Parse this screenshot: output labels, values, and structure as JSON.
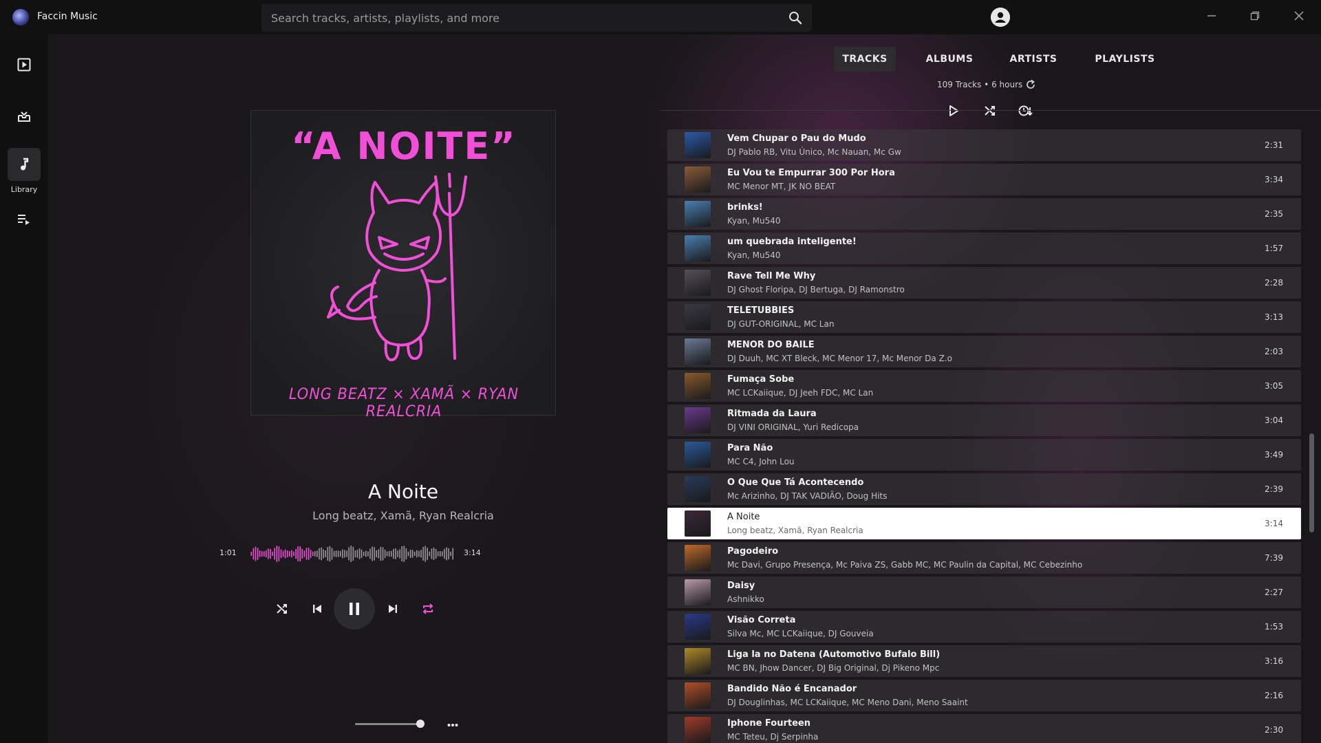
{
  "app": {
    "title": "Faccin Music"
  },
  "search": {
    "placeholder": "Search tracks, artists, playlists, and more"
  },
  "sidebar": {
    "items": [
      {
        "icon": "play-box-icon"
      },
      {
        "icon": "inbox-down-icon"
      },
      {
        "icon": "music-note-icon",
        "label": "Library"
      },
      {
        "icon": "queue-icon"
      }
    ]
  },
  "now_playing": {
    "cover": {
      "title": "“A NOITE”",
      "credits": "LONG BEATZ × XAMÃ × RYAN REALCRIA"
    },
    "title": "A Noite",
    "artists": "Long beatz,   Xamã,   Ryan Realcria",
    "elapsed": "1:01",
    "duration": "3:14",
    "progress": 0.31,
    "volume": 0.82
  },
  "library": {
    "tabs": [
      "TRACKS",
      "ALBUMS",
      "ARTISTS",
      "PLAYLISTS"
    ],
    "active_tab": "TRACKS",
    "summary": "109 Tracks • 6 hours"
  },
  "colors": {
    "accent": "#f14fd7",
    "active_row": "#ffffff"
  },
  "tracks": [
    {
      "title": "Vem Chupar o Pau do Mudo",
      "artists": "DJ Pablo RB,   Vitu Único,   Mc Nauan,   Mc Gw",
      "duration": "2:31",
      "thumb": "#2b5aa8"
    },
    {
      "title": "Eu Vou te Empurrar 300 Por Hora",
      "artists": "MC Menor MT,   JK NO BEAT",
      "duration": "3:34",
      "thumb": "#8a5b3a"
    },
    {
      "title": "brinks!",
      "artists": "Kyan,   Mu540",
      "duration": "2:35",
      "thumb": "#4a7fb0"
    },
    {
      "title": "um quebrada inteligente!",
      "artists": "Kyan,   Mu540",
      "duration": "1:57",
      "thumb": "#4a7fb0"
    },
    {
      "title": "Rave Tell Me Why",
      "artists": "DJ Ghost Floripa,   DJ Bertuga,   DJ Ramonstro",
      "duration": "2:28",
      "thumb": "#555058"
    },
    {
      "title": "TELETUBBIES",
      "artists": "DJ GUT-ORIGINAL,   MC Lan",
      "duration": "3:13",
      "thumb": "#3a3a44"
    },
    {
      "title": "MENOR DO BAILE",
      "artists": "DJ Duuh,   MC XT Bleck,   MC Menor 17,   Mc Menor Da Z.o",
      "duration": "2:03",
      "thumb": "#6a7a96"
    },
    {
      "title": "Fumaça Sobe",
      "artists": "MC LCKaiique,   DJ Jeeh FDC,   MC Lan",
      "duration": "3:05",
      "thumb": "#8a5a2a"
    },
    {
      "title": "Ritmada da Laura",
      "artists": "DJ VINI ORIGINAL,   Yuri Redicopa",
      "duration": "3:04",
      "thumb": "#6a3a8a"
    },
    {
      "title": "Para Não",
      "artists": "MC C4,   John Lou",
      "duration": "3:49",
      "thumb": "#2a5a9a"
    },
    {
      "title": "O Que Que Tá Acontecendo",
      "artists": "Mc Arizinho,   DJ TAK VADIÃO,   Doug Hits",
      "duration": "2:39",
      "thumb": "#2a3a5a"
    },
    {
      "title": "A Noite",
      "artists": "Long beatz,   Xamã,   Ryan Realcria",
      "duration": "3:14",
      "thumb": "#3a2838",
      "active": true
    },
    {
      "title": "Pagodeiro",
      "artists": "Mc Davi,   Grupo Presença,   Mc Paiva ZS,   Gabb MC,   MC Paulin da Capital,   MC Cebezinho",
      "duration": "7:39",
      "thumb": "#c06a2a"
    },
    {
      "title": "Daisy",
      "artists": "Ashnikko",
      "duration": "2:27",
      "thumb": "#b89aa8"
    },
    {
      "title": "Visão Correta",
      "artists": "Silva Mc,   MC LCKaiique,   DJ Gouveia",
      "duration": "1:53",
      "thumb": "#2a3a8a"
    },
    {
      "title": "Liga la no Datena (Automotivo Bufalo Bill)",
      "artists": "MC BN,   Jhow Dancer,   DJ Big Original,   Dj Pikeno Mpc",
      "duration": "3:16",
      "thumb": "#b08a2a"
    },
    {
      "title": "Bandido Não é Encanador",
      "artists": "DJ Douglinhas,   MC LCKaiique,   MC Meno Dani,   Meno Saaint",
      "duration": "2:16",
      "thumb": "#b0502a"
    },
    {
      "title": "Iphone Fourteen",
      "artists": "MC Teteu,   Dj Serpinha",
      "duration": "2:30",
      "thumb": "#a03a2a"
    }
  ]
}
